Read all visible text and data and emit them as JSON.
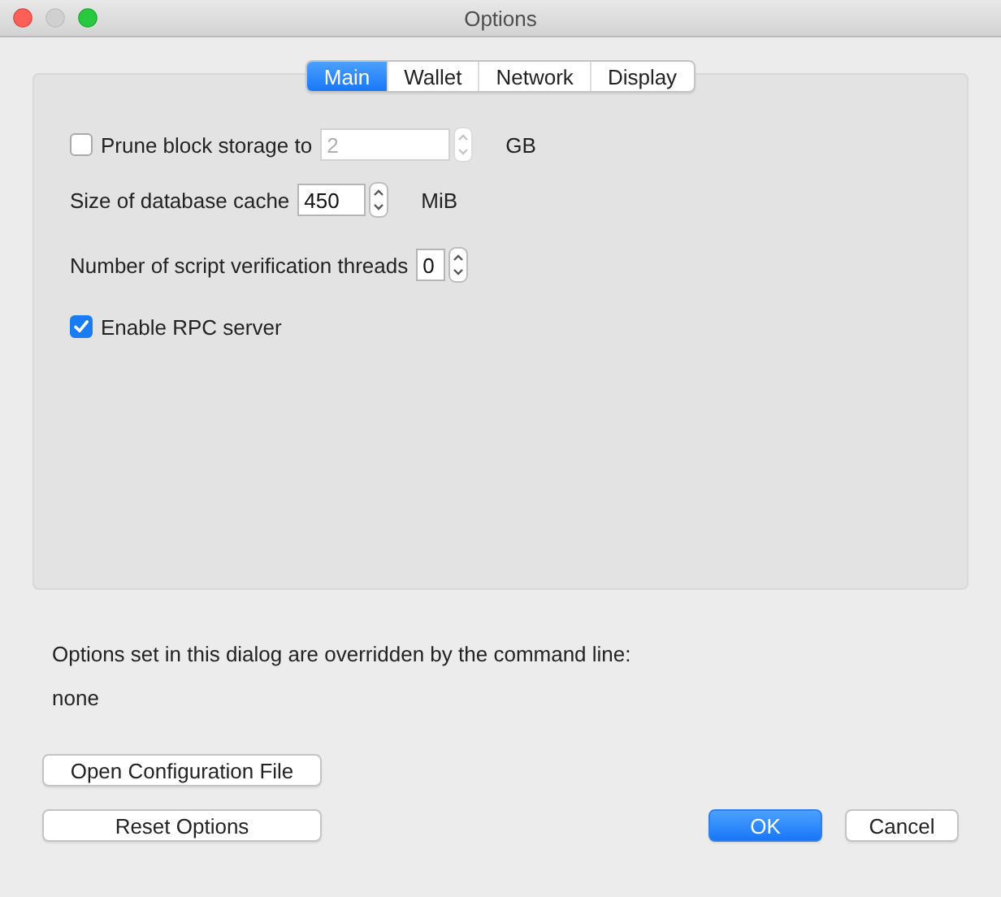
{
  "window": {
    "title": "Options"
  },
  "tabs": [
    {
      "label": "Main",
      "selected": true
    },
    {
      "label": "Wallet",
      "selected": false
    },
    {
      "label": "Network",
      "selected": false
    },
    {
      "label": "Display",
      "selected": false
    }
  ],
  "settings": [
    {
      "kind": "checkbox_spin",
      "label": "Prune block storage to",
      "checked": false,
      "value": "2",
      "disabled": true,
      "unit": "GB"
    },
    {
      "kind": "spin",
      "label": "Size of database cache",
      "value": "450",
      "disabled": false,
      "unit": "MiB"
    },
    {
      "kind": "spin",
      "label": "Number of script verification threads",
      "value": "0",
      "disabled": false
    },
    {
      "kind": "checkbox",
      "label": "Enable RPC server",
      "checked": true
    }
  ],
  "override_note": "Options set in this dialog are overridden by the command line:",
  "override_value": "none",
  "left_buttons": [
    {
      "label": "Open Configuration File",
      "default": false
    },
    {
      "label": "Reset Options",
      "default": false
    }
  ],
  "right_buttons": [
    {
      "label": "OK",
      "default": true
    },
    {
      "label": "Cancel",
      "default": false
    }
  ]
}
